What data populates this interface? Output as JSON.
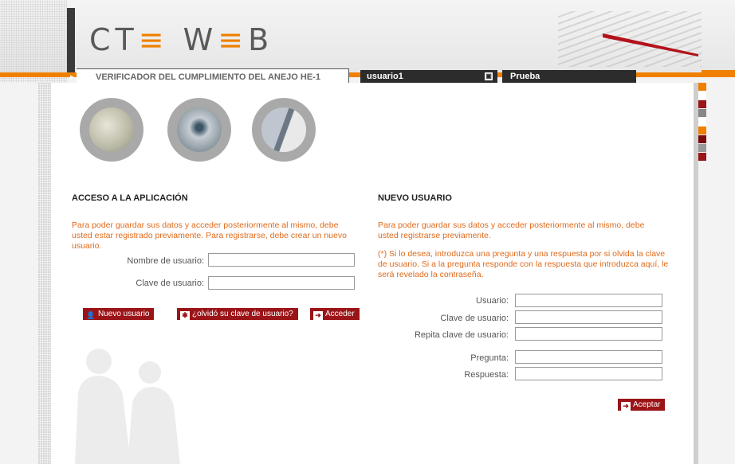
{
  "header": {
    "logo_part1": "CT",
    "logo_accent": "≡",
    "logo_part2": " W",
    "logo_accent2": "≡",
    "logo_part3": "B",
    "main_tab": "VERIFICADOR DEL CUMPLIMIENTO DEL ANEJO HE-1",
    "user_tab": "usuario1",
    "project_tab": "Prueba"
  },
  "colors": {
    "accent": "#f08000",
    "brand_red": "#9b1418",
    "warning_text": "#e06a1a"
  },
  "login": {
    "title": "ACCESO A LA APLICACIÓN",
    "info": "Para poder guardar sus datos y acceder posteriormente al mismo, debe usted estar registrado previamente. Para registrarse, debe crear un nuevo usuario.",
    "username_label": "Nombre de usuario:",
    "password_label": "Clave de usuario:",
    "username_value": "",
    "password_value": "",
    "new_user_button": "Nuevo usuario",
    "forgot_button": "¿olvidó su clave de usuario?",
    "access_button": "Acceder"
  },
  "register": {
    "title": "NUEVO USUARIO",
    "info": "Para poder guardar sus datos y acceder posteriormente al mismo, debe usted registrarse previamente.",
    "note": "(*) Si lo desea, introduzca una pregunta y una respuesta por si olvida la clave de usuario. Si a la pregunta responde con la respuesta que introduzca aquí, le será revelado la contraseña.",
    "user_label": "Usuario:",
    "password_label": "Clave de usuario:",
    "repeat_label": "Repita clave de usuario:",
    "question_label": "Pregunta:",
    "answer_label": "Respuesta:",
    "accept_button": "Aceptar"
  },
  "icons": {
    "new_user": "person-icon",
    "forgot": "asterisk-icon",
    "access": "enter-icon",
    "accept": "enter-icon",
    "user_tab": "window-icon"
  }
}
